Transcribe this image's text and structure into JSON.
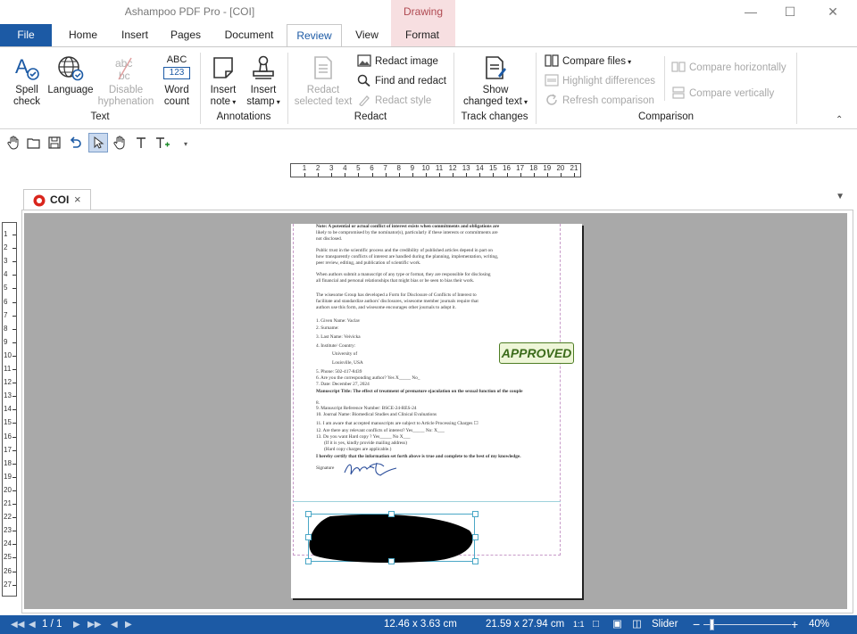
{
  "app": {
    "title": "Ashampoo PDF Pro - [COI]",
    "context_tab": "Drawing"
  },
  "tabs": [
    {
      "label": "File"
    },
    {
      "label": "Home"
    },
    {
      "label": "Insert"
    },
    {
      "label": "Pages"
    },
    {
      "label": "Document"
    },
    {
      "label": "Review"
    },
    {
      "label": "View"
    },
    {
      "label": "Format"
    }
  ],
  "help_label": "?",
  "ribbon": {
    "text_group": {
      "label": "Text",
      "spell_1": "Spell",
      "spell_2": "check",
      "language": "Language",
      "disable_1": "Disable",
      "disable_2": "hyphenation",
      "word_1": "Word",
      "word_2": "count",
      "abc_top": "ABC",
      "abc_bottom": "123"
    },
    "annotations_group": {
      "label": "Annotations",
      "note_1": "Insert",
      "note_2": "note",
      "stamp_1": "Insert",
      "stamp_2": "stamp"
    },
    "redact_group": {
      "label": "Redact",
      "selected_1": "Redact",
      "selected_2": "selected text",
      "redact_image": "Redact image",
      "find_redact": "Find and redact",
      "redact_style": "Redact style"
    },
    "track_group": {
      "label": "Track changes",
      "show_1": "Show",
      "show_2": "changed text"
    },
    "comparison_group": {
      "label": "Comparison",
      "compare_files": "Compare files",
      "highlight": "Highlight differences",
      "refresh": "Refresh comparison",
      "compare_h": "Compare horizontally",
      "compare_v": "Compare vertically"
    }
  },
  "ruler_h_ticks": [
    "1",
    "2",
    "3",
    "4",
    "5",
    "6",
    "7",
    "8",
    "9",
    "10",
    "11",
    "12",
    "13",
    "14",
    "15",
    "16",
    "17",
    "18",
    "19",
    "20",
    "21"
  ],
  "ruler_v_ticks": [
    "1",
    "2",
    "3",
    "4",
    "5",
    "6",
    "7",
    "8",
    "9",
    "10",
    "11",
    "12",
    "13",
    "14",
    "15",
    "16",
    "17",
    "18",
    "19",
    "20",
    "21",
    "22",
    "23",
    "24",
    "25",
    "26",
    "27"
  ],
  "document_tab": {
    "label": "COI",
    "close": "×"
  },
  "page": {
    "lines": [
      "Note: A potential or actual conflict of interest exists when commitments and obligations are",
      "likely to be compromised by the nominator(s), particularly if these interests or commitments are",
      "not disclosed.",
      "Public trust in the scientific process and the credibility of published articles depend in part on",
      "how transparently conflicts of interest are handled during the planning, implementation, writing,",
      "peer review, editing, and publication of scientific work.",
      "When authors submit a manuscript of any type or format, they are responsible for disclosing",
      "all financial and personal relationships that might bias or be seen to bias their work.",
      "The wisesome Group has developed a Form for Disclosure of Conflicts of Interest to",
      "facilitate and standardize authors' disclosures, wisesome member journals require that",
      "authors use this form, and wisesome encourages other journals to adopt it.",
      "1.  Given Name: Vaclav",
      "2.  Surname:",
      "3.  Last Name: Veivicka",
      "4.  Institute/ Country:",
      "University of",
      "Louisville, USA",
      "5.  Phone: 502-417-8439",
      "6.  Are you the corresponding author? Yes X_____ No_",
      "7.  Date:  December 27, 2024",
      "Manuscript Title: The effect of treatment of premature ejaculation on the sexual function of the couple",
      "8.",
      "9.   Manuscript Reference Number: BSCE-24-RES-24",
      "10. Journal Name: Biomedical Studies and Clinical Evaluations",
      "11. I am aware that accepted manuscripts are subject to Article Processing Charges ☐",
      "12. Are there any relevant conflicts of interest? Yes_____ No: X___",
      "13. Do you want Hard copy ? Yes_____ No X___",
      "(If it is yes, kindly provide mailing address)",
      "(Hard copy charges are applicable.)",
      "I hereby certify that the information set forth above is true and complete to the best of my knowledge.",
      "Signature"
    ],
    "stamp": "APPROVED"
  },
  "status": {
    "page": "1 / 1",
    "selection_size": "12.46 x 3.63 cm",
    "page_size": "21.59 x 27.94 cm",
    "slider_label": "Slider",
    "zoom": "40%",
    "zoom_fraction": 0.4
  },
  "colors": {
    "brand_blue": "#1c5aa5",
    "context_pink": "#f7dfe1",
    "stamp_green": "#4e7d24"
  }
}
